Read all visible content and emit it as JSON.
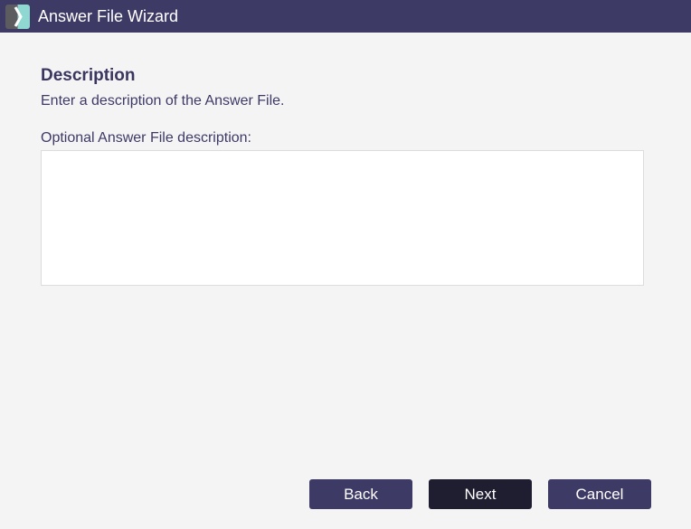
{
  "window": {
    "title": "Answer File Wizard",
    "app_icon": "chevron-logo-icon"
  },
  "page": {
    "heading": "Description",
    "instruction": "Enter a description of the Answer File."
  },
  "form": {
    "description_label": "Optional Answer File description:",
    "description_value": ""
  },
  "buttons": {
    "back_label": "Back",
    "next_label": "Next",
    "cancel_label": "Cancel"
  },
  "colors": {
    "titlebar": "#3e3a66",
    "primary_button": "#3e3a66",
    "focused_button": "#1f1d30",
    "background": "#f4f4f5"
  }
}
